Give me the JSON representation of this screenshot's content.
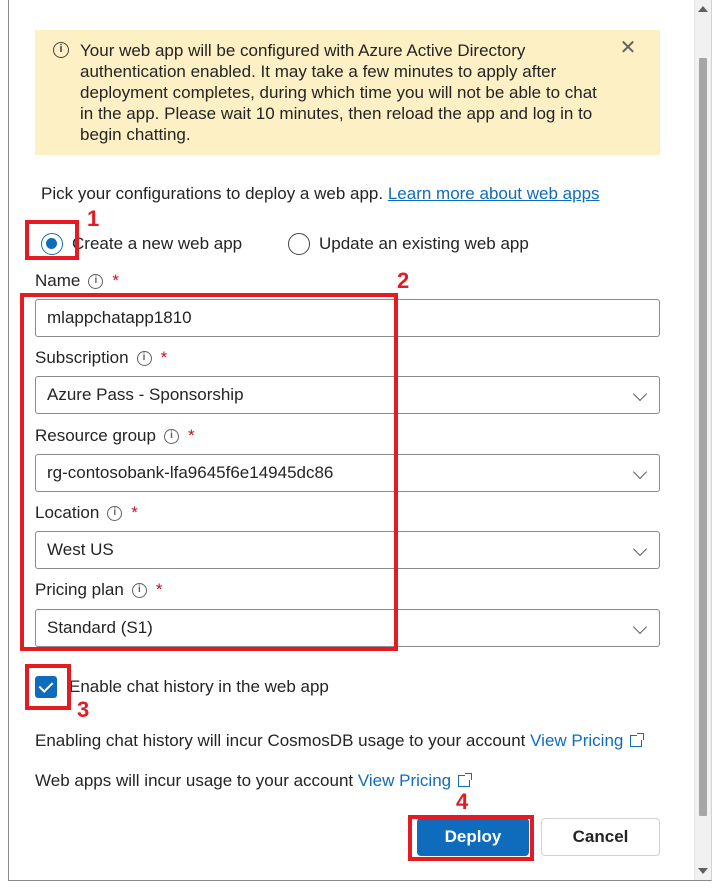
{
  "banner": {
    "message": "Your web app will be configured with Azure Active Directory authentication enabled. It may take a few minutes to apply after deployment completes, during which time you will not be able to chat in the app. Please wait 10 minutes, then reload the app and log in to begin chatting.",
    "info_icon": "info-icon",
    "close_icon": "close-icon"
  },
  "intro": {
    "text": "Pick your configurations to deploy a web app.",
    "link": "Learn more about web apps"
  },
  "mode": {
    "create_label": "Create a new web app",
    "update_label": "Update an existing web app",
    "selected": "create"
  },
  "fields": {
    "name": {
      "label": "Name",
      "value": "mlappchatapp1810"
    },
    "subscription": {
      "label": "Subscription",
      "value": "Azure Pass - Sponsorship"
    },
    "resource_group": {
      "label": "Resource group",
      "value": "rg-contosobank-lfa9645f6e14945dc86"
    },
    "location": {
      "label": "Location",
      "value": "West US"
    },
    "pricing_plan": {
      "label": "Pricing plan",
      "value": "Standard (S1)"
    },
    "required_marker": "*"
  },
  "chat_history": {
    "label": "Enable chat history in the web app",
    "checked": true
  },
  "notes": {
    "cosmos_text": "Enabling chat history will incur CosmosDB usage to your account",
    "cosmos_link": "View Pricing",
    "usage_text": "Web apps will incur usage to your account",
    "usage_link": "View Pricing"
  },
  "buttons": {
    "deploy": "Deploy",
    "cancel": "Cancel"
  },
  "annotations": {
    "one": "1",
    "two": "2",
    "three": "3",
    "four": "4",
    "color": "#e41b23"
  },
  "colors": {
    "accent": "#0f6cbd",
    "banner_bg": "#fdf0c4",
    "required": "#c50f1f"
  }
}
